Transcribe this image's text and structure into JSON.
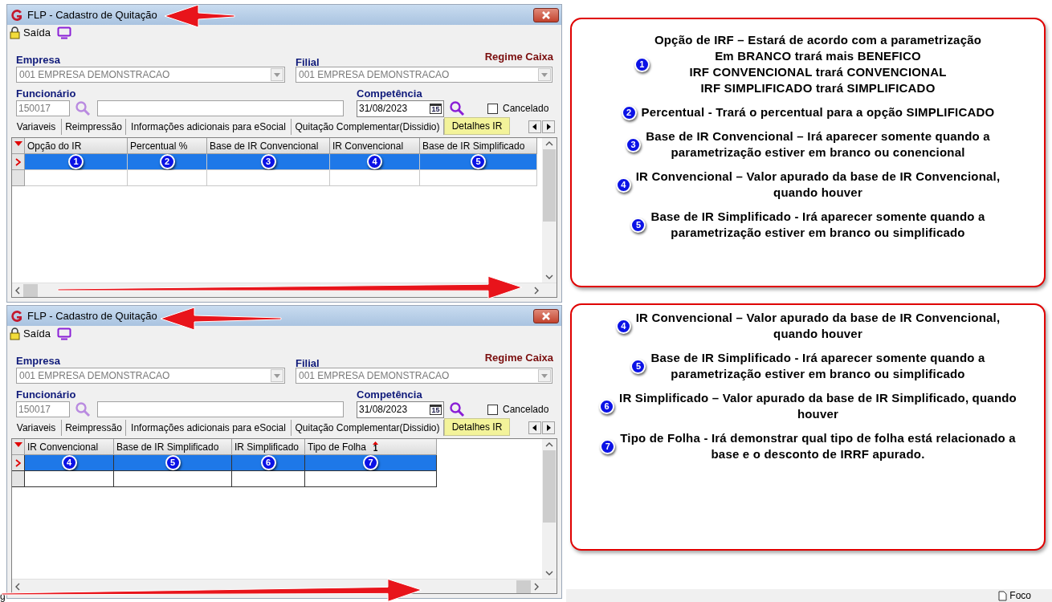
{
  "windows": [
    {
      "title": "FLP - Cadastro de Quitação",
      "exit_label": "Saída",
      "empresa": {
        "label": "Empresa",
        "value": "001 EMPRESA DEMONSTRACAO"
      },
      "filial": {
        "label": "Filial",
        "value": "001 EMPRESA DEMONSTRACAO"
      },
      "regime": "Regime Caixa",
      "funcionario": {
        "label": "Funcionário",
        "code": "150017"
      },
      "competencia": {
        "label": "Competência",
        "value": "31/08/2023",
        "calendar_day": "15"
      },
      "cancelado": {
        "label": "Cancelado",
        "checked": false
      },
      "tabs": [
        {
          "label": "Variaveis",
          "selected": false
        },
        {
          "label": "Reimpressão",
          "selected": false
        },
        {
          "label": "Informações adicionais para eSocial",
          "selected": false
        },
        {
          "label": "Quitação Complementar(Dissidio)",
          "selected": false
        },
        {
          "label": "Detalhes IR",
          "selected": true
        }
      ],
      "grid": {
        "columns": [
          {
            "label": "Opção do IR",
            "badge": "1"
          },
          {
            "label": "Percentual %",
            "badge": "2"
          },
          {
            "label": "Base de IR Convencional",
            "badge": "3"
          },
          {
            "label": "IR Convencional",
            "badge": "4"
          },
          {
            "label": "Base de IR Simplificado",
            "badge": "5"
          }
        ],
        "rows": [
          {
            "selected": true
          },
          {
            "selected": false
          }
        ]
      }
    },
    {
      "title": "FLP - Cadastro de Quitação",
      "exit_label": "Saída",
      "empresa": {
        "label": "Empresa",
        "value": "001 EMPRESA DEMONSTRACAO"
      },
      "filial": {
        "label": "Filial",
        "value": "001 EMPRESA DEMONSTRACAO"
      },
      "regime": "Regime Caixa",
      "funcionario": {
        "label": "Funcionário",
        "code": "150017"
      },
      "competencia": {
        "label": "Competência",
        "value": "31/08/2023",
        "calendar_day": "15"
      },
      "cancelado": {
        "label": "Cancelado",
        "checked": false
      },
      "tabs": [
        {
          "label": "Variaveis",
          "selected": false
        },
        {
          "label": "Reimpressão",
          "selected": false
        },
        {
          "label": "Informações adicionais para eSocial",
          "selected": false
        },
        {
          "label": "Quitação Complementar(Dissidio)",
          "selected": false
        },
        {
          "label": "Detalhes IR",
          "selected": true
        }
      ],
      "grid": {
        "columns": [
          {
            "label": "IR Convencional",
            "badge": "4"
          },
          {
            "label": "Base de IR Simplificado",
            "badge": "5"
          },
          {
            "label": "IR Simplificado",
            "badge": "6"
          },
          {
            "label": "Tipo de Folha",
            "badge": "7",
            "sort_mark": "1"
          }
        ],
        "rows": [
          {
            "selected": true
          },
          {
            "selected": false
          }
        ]
      }
    }
  ],
  "callouts": [
    {
      "notes": [
        {
          "badge": "1",
          "lines": [
            "Opção de IRF – Estará de acordo com a parametrização",
            "Em BRANCO trará mais BENEFICO",
            "IRF CONVENCIONAL  trará CONVENCIONAL",
            "IRF SIMPLIFICADO trará  SIMPLIFICADO"
          ]
        },
        {
          "badge": "2",
          "lines": [
            "Percentual - Trará  o percentual para a opção SIMPLIFICADO"
          ]
        },
        {
          "badge": "3",
          "lines": [
            "Base de IR Convencional – Irá aparecer somente quando a",
            "parametrização estiver em branco ou conencional"
          ]
        },
        {
          "badge": "4",
          "lines": [
            "IR Convencional – Valor apurado da base de IR Convencional,",
            "quando houver"
          ]
        },
        {
          "badge": "5",
          "lines": [
            "Base de IR Simplificado - Irá aparecer somente quando a",
            "parametrização estiver em branco ou simplificado"
          ]
        }
      ]
    },
    {
      "notes": [
        {
          "badge": "4",
          "lines": [
            "IR Convencional – Valor apurado da base de IR Convencional,",
            "quando houver"
          ]
        },
        {
          "badge": "5",
          "lines": [
            "Base de IR Simplificado - Irá aparecer somente quando a",
            "parametrização estiver em branco ou simplificado"
          ]
        },
        {
          "badge": "6",
          "lines": [
            "IR Simplificado – Valor apurado da base de IR Simplificado, quando",
            "houver"
          ]
        },
        {
          "badge": "7",
          "lines": [
            "Tipo de Folha - Irá demonstrar qual tipo de folha está relacionado a",
            "base e o desconto de IRRF apurado."
          ]
        }
      ]
    }
  ],
  "status_bar": {
    "focus_label": "Foco"
  },
  "edge_text": "g"
}
